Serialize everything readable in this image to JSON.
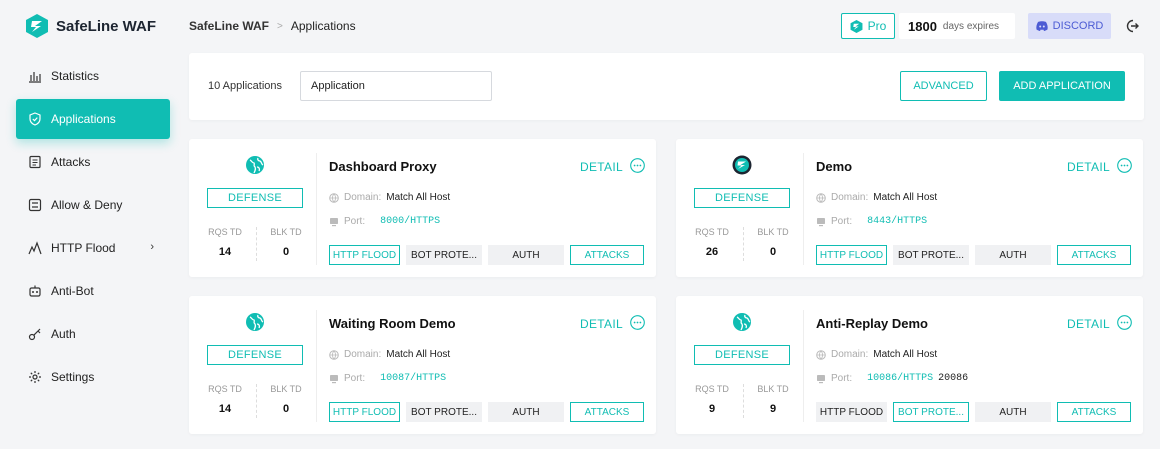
{
  "brand": {
    "name": "SafeLine WAF",
    "accent": "#10bdb3"
  },
  "sidebar": {
    "items": [
      {
        "label": "Statistics",
        "icon": "bar-chart-icon",
        "active": false
      },
      {
        "label": "Applications",
        "icon": "shield-icon",
        "active": true
      },
      {
        "label": "Attacks",
        "icon": "list-icon",
        "active": false
      },
      {
        "label": "Allow & Deny",
        "icon": "allow-deny-icon",
        "active": false
      },
      {
        "label": "HTTP Flood",
        "icon": "flood-icon",
        "active": false,
        "chevron": "›"
      },
      {
        "label": "Anti-Bot",
        "icon": "robot-icon",
        "active": false
      },
      {
        "label": "Auth",
        "icon": "key-icon",
        "active": false
      },
      {
        "label": "Settings",
        "icon": "gear-icon",
        "active": false
      }
    ]
  },
  "header": {
    "breadcrumb_root": "SafeLine WAF",
    "breadcrumb_sep": ">",
    "breadcrumb_current": "Applications",
    "pro_label": "Pro",
    "days": "1800",
    "days_label": "days expires",
    "discord_label": "DISCORD"
  },
  "toolbar": {
    "count_label": "10 Applications",
    "search_value": "Application",
    "advanced_label": "ADVANCED",
    "add_label": "ADD APPLICATION"
  },
  "card_labels": {
    "defense": "DEFENSE",
    "rqs": "RQS TD",
    "blk": "BLK TD",
    "detail": "DETAIL",
    "domain_key": "Domain:",
    "port_key": "Port:",
    "tag_flood": "HTTP FLOOD",
    "tag_bot": "BOT PROTE...",
    "tag_auth": "AUTH",
    "tag_attacks": "ATTACKS"
  },
  "apps": [
    {
      "name": "Dashboard Proxy",
      "icon": "globe-icon",
      "rqs": "14",
      "blk": "0",
      "domain": "Match All Host",
      "port": "8000/HTTPS",
      "port_extra": "",
      "flood_on": true,
      "bot_on": false,
      "auth_on": false,
      "attacks_on": true
    },
    {
      "name": "Demo",
      "icon": "safeline-logo-icon",
      "rqs": "26",
      "blk": "0",
      "domain": "Match All Host",
      "port": "8443/HTTPS",
      "port_extra": "",
      "flood_on": true,
      "bot_on": false,
      "auth_on": false,
      "attacks_on": true
    },
    {
      "name": "Waiting Room Demo",
      "icon": "globe-icon",
      "rqs": "14",
      "blk": "0",
      "domain": "Match All Host",
      "port": "10087/HTTPS",
      "port_extra": "",
      "flood_on": true,
      "bot_on": false,
      "auth_on": false,
      "attacks_on": true
    },
    {
      "name": "Anti-Replay Demo",
      "icon": "globe-icon",
      "rqs": "9",
      "blk": "9",
      "domain": "Match All Host",
      "port": "10086/HTTPS",
      "port_extra": "20086",
      "flood_on": false,
      "bot_on": true,
      "auth_on": false,
      "attacks_on": true
    }
  ]
}
